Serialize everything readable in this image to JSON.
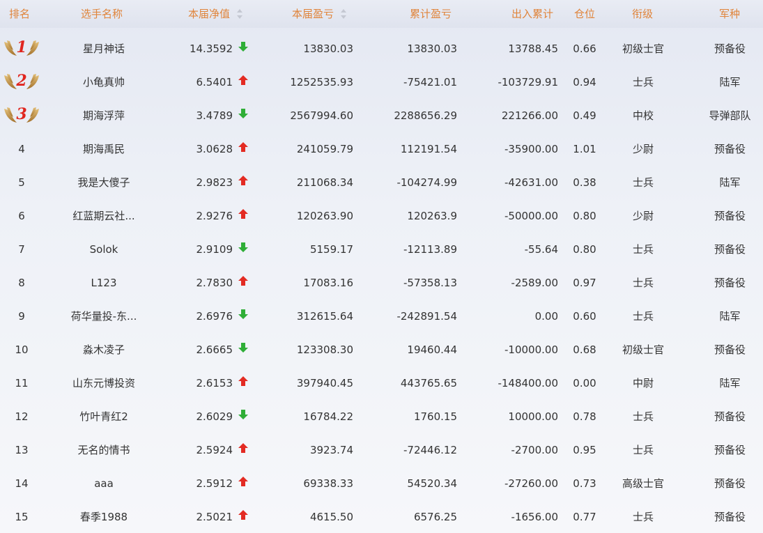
{
  "header": {
    "rank": "排名",
    "name": "选手名称",
    "nav": "本届净值",
    "pnl": "本届盈亏",
    "cum": "累计盈亏",
    "flow": "出入累计",
    "pos": "仓位",
    "rank_title": "衔级",
    "arm": "军种"
  },
  "colors": {
    "header_text": "#e0843a",
    "arrow_up": "#e32b23",
    "arrow_down": "#2fae37",
    "medal_number": "#e0261f"
  },
  "rows": [
    {
      "rank": "1",
      "name": "星月神话",
      "nav": "14.3592",
      "trend": "down",
      "pnl": "13830.03",
      "cum": "13830.03",
      "flow": "13788.45",
      "pos": "0.66",
      "title": "初级士官",
      "arm": "预备役"
    },
    {
      "rank": "2",
      "name": "小龟真帅",
      "nav": "6.5401",
      "trend": "up",
      "pnl": "1252535.93",
      "cum": "-75421.01",
      "flow": "-103729.91",
      "pos": "0.94",
      "title": "士兵",
      "arm": "陆军"
    },
    {
      "rank": "3",
      "name": "期海浮萍",
      "nav": "3.4789",
      "trend": "down",
      "pnl": "2567994.60",
      "cum": "2288656.29",
      "flow": "221266.00",
      "pos": "0.49",
      "title": "中校",
      "arm": "导弹部队"
    },
    {
      "rank": "4",
      "name": "期海禹民",
      "nav": "3.0628",
      "trend": "up",
      "pnl": "241059.79",
      "cum": "112191.54",
      "flow": "-35900.00",
      "pos": "1.01",
      "title": "少尉",
      "arm": "预备役"
    },
    {
      "rank": "5",
      "name": "我是大傻子",
      "nav": "2.9823",
      "trend": "up",
      "pnl": "211068.34",
      "cum": "-104274.99",
      "flow": "-42631.00",
      "pos": "0.38",
      "title": "士兵",
      "arm": "陆军"
    },
    {
      "rank": "6",
      "name": "红蓝期云社...",
      "nav": "2.9276",
      "trend": "up",
      "pnl": "120263.90",
      "cum": "120263.9",
      "flow": "-50000.00",
      "pos": "0.80",
      "title": "少尉",
      "arm": "预备役"
    },
    {
      "rank": "7",
      "name": "Solok",
      "nav": "2.9109",
      "trend": "down",
      "pnl": "5159.17",
      "cum": "-12113.89",
      "flow": "-55.64",
      "pos": "0.80",
      "title": "士兵",
      "arm": "预备役"
    },
    {
      "rank": "8",
      "name": "L123",
      "nav": "2.7830",
      "trend": "up",
      "pnl": "17083.16",
      "cum": "-57358.13",
      "flow": "-2589.00",
      "pos": "0.97",
      "title": "士兵",
      "arm": "预备役"
    },
    {
      "rank": "9",
      "name": "荷华量投-东...",
      "nav": "2.6976",
      "trend": "down",
      "pnl": "312615.64",
      "cum": "-242891.54",
      "flow": "0.00",
      "pos": "0.60",
      "title": "士兵",
      "arm": "陆军"
    },
    {
      "rank": "10",
      "name": "淼木凌子",
      "nav": "2.6665",
      "trend": "down",
      "pnl": "123308.30",
      "cum": "19460.44",
      "flow": "-10000.00",
      "pos": "0.68",
      "title": "初级士官",
      "arm": "预备役"
    },
    {
      "rank": "11",
      "name": "山东元博投资",
      "nav": "2.6153",
      "trend": "up",
      "pnl": "397940.45",
      "cum": "443765.65",
      "flow": "-148400.00",
      "pos": "0.00",
      "title": "中尉",
      "arm": "陆军"
    },
    {
      "rank": "12",
      "name": "竹叶青红2",
      "nav": "2.6029",
      "trend": "down",
      "pnl": "16784.22",
      "cum": "1760.15",
      "flow": "10000.00",
      "pos": "0.78",
      "title": "士兵",
      "arm": "预备役"
    },
    {
      "rank": "13",
      "name": "无名的情书",
      "nav": "2.5924",
      "trend": "up",
      "pnl": "3923.74",
      "cum": "-72446.12",
      "flow": "-2700.00",
      "pos": "0.95",
      "title": "士兵",
      "arm": "预备役"
    },
    {
      "rank": "14",
      "name": "aaa",
      "nav": "2.5912",
      "trend": "up",
      "pnl": "69338.33",
      "cum": "54520.34",
      "flow": "-27260.00",
      "pos": "0.73",
      "title": "高级士官",
      "arm": "预备役"
    },
    {
      "rank": "15",
      "name": "春季1988",
      "nav": "2.5021",
      "trend": "up",
      "pnl": "4615.50",
      "cum": "6576.25",
      "flow": "-1656.00",
      "pos": "0.77",
      "title": "士兵",
      "arm": "预备役"
    }
  ]
}
